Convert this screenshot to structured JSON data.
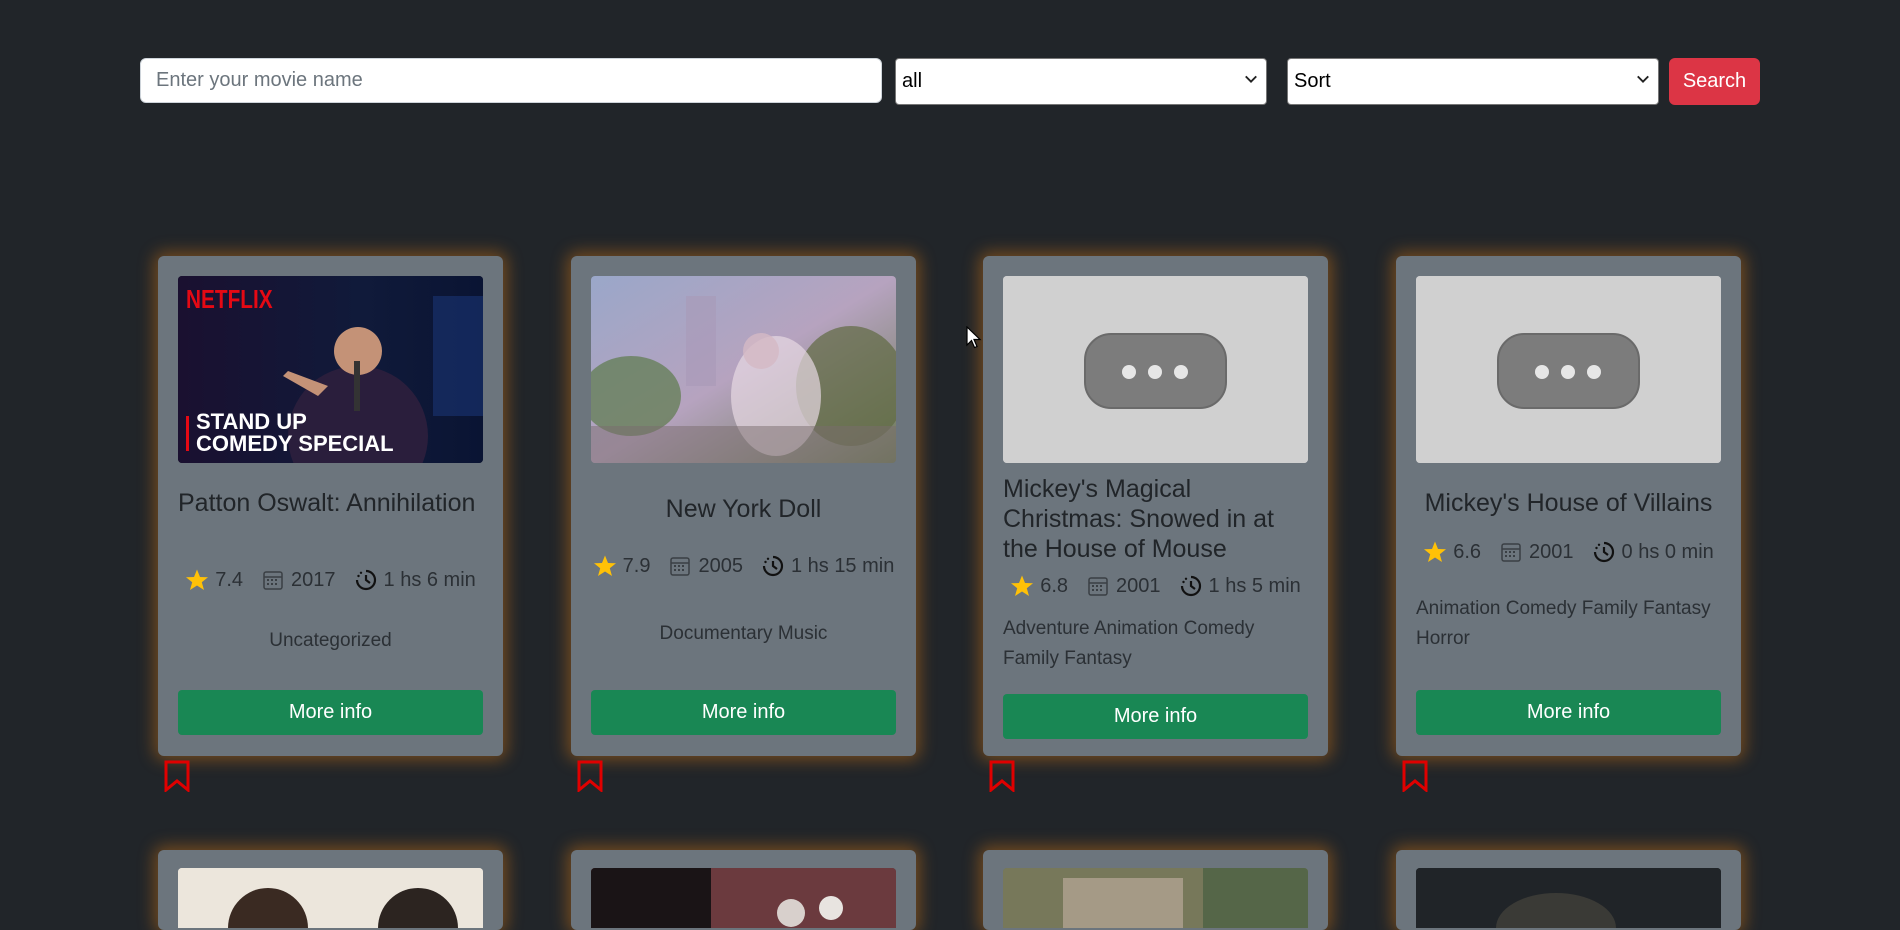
{
  "search": {
    "placeholder": "Enter your movie name",
    "genre_selected": "all",
    "sort_selected": "Sort",
    "button_label": "Search"
  },
  "movies": [
    {
      "title": "Patton Oswalt: Annihilation",
      "rating": "7.4",
      "year": "2017",
      "duration": "1 hs 6 min",
      "genres": "Uncategorized",
      "button": "More info",
      "poster_text": [
        "NETFLIX",
        "STAND UP",
        "COMEDY SPECIAL"
      ]
    },
    {
      "title": "New York Doll",
      "rating": "7.9",
      "year": "2005",
      "duration": "1 hs 15 min",
      "genres": "Documentary Music",
      "button": "More info"
    },
    {
      "title": "Mickey's Magical Christmas: Snowed in at the House of Mouse",
      "rating": "6.8",
      "year": "2001",
      "duration": "1 hs 5 min",
      "genres": "Adventure Animation Comedy Family Fantasy",
      "button": "More info"
    },
    {
      "title": "Mickey's House of Villains",
      "rating": "6.6",
      "year": "2001",
      "duration": "0 hs 0 min",
      "genres": "Animation Comedy Family Fantasy Horror",
      "button": "More info"
    }
  ],
  "colors": {
    "background": "#212529",
    "card": "#6c757d",
    "search_button": "#dc3545",
    "more_info_button": "#198754",
    "star": "#ffc107",
    "bookmark": "#e00000",
    "card_glow": "#d67814"
  },
  "icons": [
    "star-icon",
    "calendar-icon",
    "clock-history-icon",
    "bookmark-icon",
    "chevron-down-icon",
    "cursor-icon"
  ]
}
